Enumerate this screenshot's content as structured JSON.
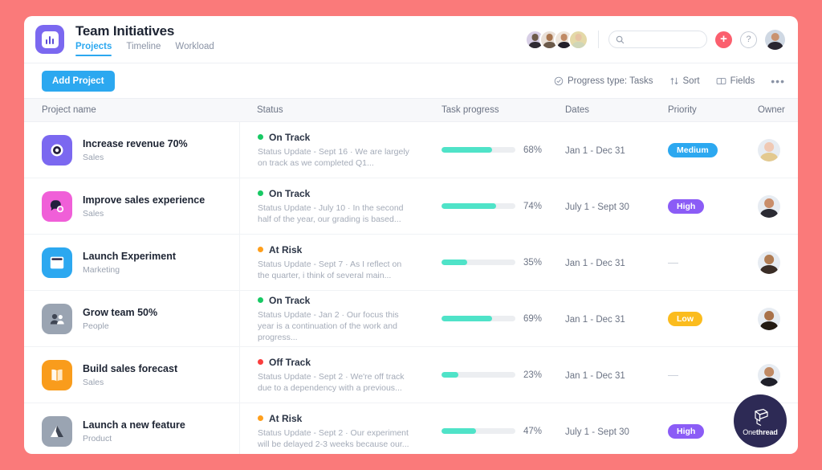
{
  "theme": {
    "page_bg": "#fa7a7a",
    "accent_blue": "#2ca8f0",
    "progress_fill": "#4fe3c8",
    "brand_purple": "#7b68f0",
    "plus_red": "#fb5f6e"
  },
  "header": {
    "title": "Team Initiatives",
    "logo_icon": "bar-chart-logo-icon",
    "tabs": [
      {
        "label": "Projects",
        "active": true
      },
      {
        "label": "Timeline",
        "active": false
      },
      {
        "label": "Workload",
        "active": false
      }
    ],
    "search": {
      "value": "",
      "placeholder": "",
      "icon": "search-icon"
    },
    "add_icon": "plus-icon",
    "help_icon": "question-mark-icon",
    "member_avatars": 4
  },
  "toolbar": {
    "add_project_label": "Add Project",
    "progress_type_label": "Progress type: Tasks",
    "progress_type_icon": "check-circle-icon",
    "sort_label": "Sort",
    "sort_icon": "sort-arrows-icon",
    "fields_label": "Fields",
    "fields_icon": "columns-icon",
    "more_label": "•••"
  },
  "table": {
    "columns": [
      "Project name",
      "Status",
      "Task progress",
      "Dates",
      "Priority",
      "Owner"
    ],
    "rows": [
      {
        "name": "Increase revenue 70%",
        "team": "Sales",
        "icon": "target-icon",
        "icon_bg": "#7b68f0",
        "status": "On Track",
        "status_color": "#18c964",
        "update": "Status Update - Sept 16 · We are largely on track as we completed Q1...",
        "progress": 68,
        "progress_label": "68%",
        "dates": "Jan 1 - Dec 31",
        "priority": "Medium",
        "priority_color": "#2ca8f0",
        "owner_hair": "#e3c98f",
        "owner_skin": "#f0c9b4"
      },
      {
        "name": "Improve sales experience",
        "team": "Sales",
        "icon": "chat-bubble-icon",
        "icon_bg": "#f05fd8",
        "status": "On Track",
        "status_color": "#18c964",
        "update": "Status Update - July 10 · In the second half of the year, our grading is based...",
        "progress": 74,
        "progress_label": "74%",
        "dates": "July 1 - Sept 30",
        "priority": "High",
        "priority_color": "#8b5cf6",
        "owner_hair": "#2b2b33",
        "owner_skin": "#c98e6b"
      },
      {
        "name": "Launch Experiment",
        "team": "Marketing",
        "icon": "code-window-icon",
        "icon_bg": "#2ca8f0",
        "status": "At Risk",
        "status_color": "#ff9f1c",
        "update": "Status Update - Sept 7 · As I reflect on the quarter, i think of several main...",
        "progress": 35,
        "progress_label": "35%",
        "dates": "Jan 1 - Dec 31",
        "priority": "",
        "priority_color": "",
        "owner_hair": "#3a2d26",
        "owner_skin": "#b07c53"
      },
      {
        "name": "Grow team 50%",
        "team": "People",
        "icon": "people-icon",
        "icon_bg": "#9aa4b2",
        "status": "On Track",
        "status_color": "#18c964",
        "update": "Status Update - Jan 2 · Our focus this year is a continuation of the work and progress...",
        "progress": 69,
        "progress_label": "69%",
        "dates": "Jan 1 - Dec 31",
        "priority": "Low",
        "priority_color": "#fbbc1e",
        "owner_hair": "#221a12",
        "owner_skin": "#a9724a"
      },
      {
        "name": "Build sales forecast",
        "team": "Sales",
        "icon": "book-icon",
        "icon_bg": "#f99c1c",
        "status": "Off Track",
        "status_color": "#fa3e3e",
        "update": "Status Update - Sept 2 · We're off track due to a dependency with a previous...",
        "progress": 23,
        "progress_label": "23%",
        "dates": "Jan 1 - Dec 31",
        "priority": "",
        "priority_color": "",
        "owner_hair": "#20202a",
        "owner_skin": "#c08a64"
      },
      {
        "name": "Launch a new feature",
        "team": "Product",
        "icon": "flask-icon",
        "icon_bg": "#9aa4b2",
        "status": "At Risk",
        "status_color": "#ff9f1c",
        "update": "Status Update - Sept 2 · Our experiment will be delayed 2-3 weeks because our...",
        "progress": 47,
        "progress_label": "47%",
        "dates": "July 1 - Sept 30",
        "priority": "High",
        "priority_color": "#8b5cf6",
        "owner_hair": "#1f1b20",
        "owner_skin": "#c18a68"
      }
    ]
  },
  "badge": {
    "name_prefix": "One",
    "name_suffix": "thread",
    "icon": "onethread-logo-icon"
  }
}
